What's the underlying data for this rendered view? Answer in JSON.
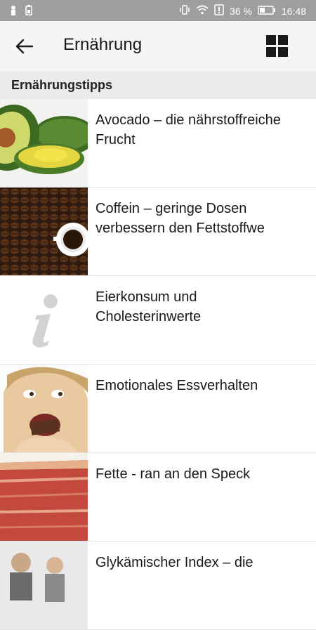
{
  "statusbar": {
    "battery": "36 %",
    "time": "16:48"
  },
  "toolbar": {
    "title": "Ernährung"
  },
  "section": {
    "title": "Ernährungstipps"
  },
  "items": [
    {
      "title": "Avocado – die nährstoffreiche Frucht",
      "thumb": "avocado-image"
    },
    {
      "title": "Coffein – geringe Dosen verbessern den Fettstoffwe",
      "thumb": "coffee-image"
    },
    {
      "title": "Eierkonsum und Cholesterinwerte",
      "thumb": "info-icon"
    },
    {
      "title": "Emotionales Essverhalten",
      "thumb": "woman-eating-chocolate-image"
    },
    {
      "title": "Fette - ran an den Speck",
      "thumb": "bacon-image"
    },
    {
      "title": "Glykämischer Index – die",
      "thumb": "people-image"
    }
  ],
  "colors": {
    "statusbar": "#9e9e9e",
    "toolbar": "#f5f5f5",
    "section": "#ebebeb"
  }
}
